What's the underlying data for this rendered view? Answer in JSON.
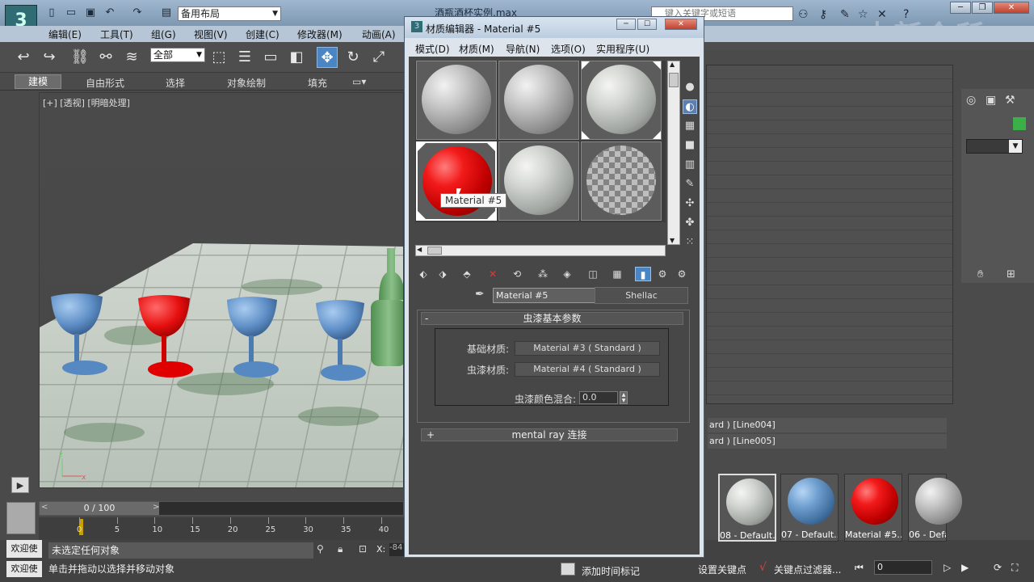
{
  "app": {
    "file_title": "酒瓶酒杯实例.max",
    "workspace": "备用布局",
    "search_placeholder": "键入关键字或短语",
    "selection_filter": "全部",
    "watermark": "中新会所"
  },
  "menubar": [
    "编辑(E)",
    "工具(T)",
    "组(G)",
    "视图(V)",
    "创建(C)",
    "修改器(M)",
    "动画(A)"
  ],
  "ribbon_tabs": [
    "建模",
    "自由形式",
    "选择",
    "对象绘制",
    "填充"
  ],
  "viewport": {
    "label": "[+] [透视] [明暗处理]"
  },
  "timeline": {
    "frame_display": "0 / 100",
    "ticks": [
      "0",
      "5",
      "10",
      "15",
      "20",
      "25",
      "30",
      "35",
      "40"
    ]
  },
  "status": {
    "welcome": "欢迎使",
    "selection": "未选定任何对象",
    "prompt": "单击并拖动以选择并移动对象",
    "add_time_tag": "添加时间标记",
    "set_key": "设置关键点",
    "key_filters": "关键点过滤器...",
    "frame": "0",
    "coord_label": "X:",
    "coord_value": "-84"
  },
  "command_panel": {
    "rows": [
      {
        "text": "ard ) [Line004]"
      },
      {
        "text": "ard ) [Line005]"
      }
    ],
    "thumbnails": [
      {
        "label": "08 - Default...",
        "type": "stone"
      },
      {
        "label": "07 - Default...",
        "type": "blue"
      },
      {
        "label": "Material #5...",
        "type": "red"
      },
      {
        "label": "06 - Defa",
        "type": "gray"
      }
    ]
  },
  "material_editor": {
    "title": "材质编辑器 - Material #5",
    "menu": [
      "模式(D)",
      "材质(M)",
      "导航(N)",
      "选项(O)",
      "实用程序(U)"
    ],
    "slots": [
      {
        "type": "gray"
      },
      {
        "type": "gray"
      },
      {
        "type": "stone"
      },
      {
        "type": "red",
        "active": true
      },
      {
        "type": "stone"
      },
      {
        "type": "checker"
      }
    ],
    "tooltip": "Material #5",
    "material_name": "Material #5",
    "material_type": "Shellac",
    "rollout_title": "虫漆基本参数",
    "rollout_sign": "-",
    "base_label": "基础材质:",
    "base_value": "Material #3  ( Standard )",
    "shellac_label": "虫漆材质:",
    "shellac_value": "Material #4  ( Standard )",
    "blend_label": "虫漆颜色混合:",
    "blend_value": "0.0",
    "mentalray_title": "mental ray 连接",
    "mentalray_sign": "+"
  }
}
